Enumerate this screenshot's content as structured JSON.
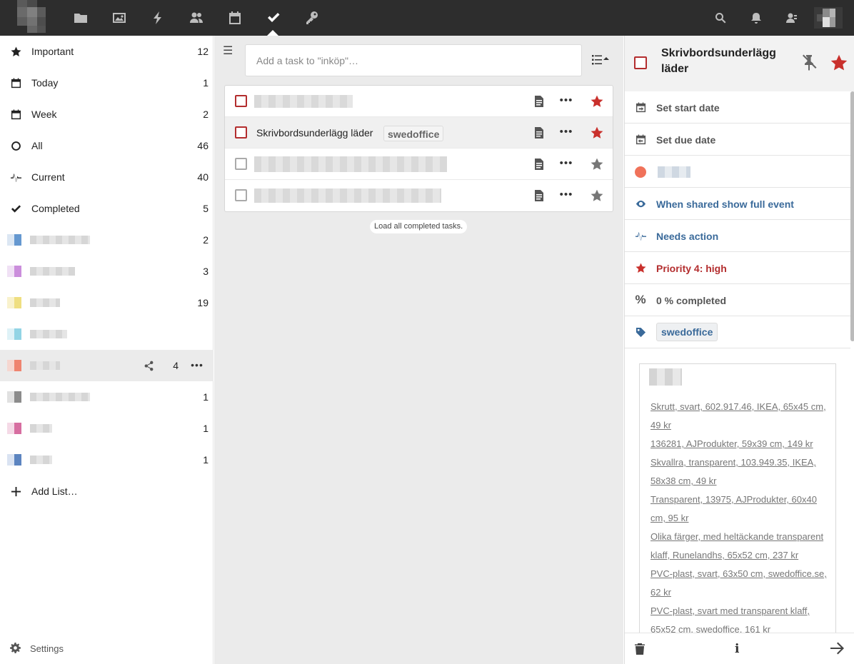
{
  "app": {
    "nav_icons": [
      "files-icon",
      "gallery-icon",
      "activity-icon",
      "contacts-icon",
      "calendar-icon",
      "tasks-icon",
      "passwords-icon"
    ],
    "active_app": "tasks-icon",
    "right_icons": [
      "search-icon",
      "notifications-icon",
      "contacts-menu-icon"
    ]
  },
  "sidebar": {
    "smart_lists": [
      {
        "label": "Important",
        "count": "12",
        "icon": "star-icon"
      },
      {
        "label": "Today",
        "count": "1",
        "icon": "calendar-day-icon"
      },
      {
        "label": "Week",
        "count": "2",
        "icon": "calendar-week-icon"
      },
      {
        "label": "All",
        "count": "46",
        "icon": "circle-icon"
      },
      {
        "label": "Current",
        "count": "40",
        "icon": "pulse-icon"
      },
      {
        "label": "Completed",
        "count": "5",
        "icon": "checkmark-icon"
      }
    ],
    "calendar_lists": [
      {
        "count": "2",
        "color": "#4a86c8"
      },
      {
        "count": "3",
        "color": "#c27ad6"
      },
      {
        "count": "19",
        "color": "#ecd96b"
      },
      {
        "count": "",
        "color": "#7fcde0"
      },
      {
        "count": "4",
        "color": "#f0725a"
      },
      {
        "count": "1",
        "color": "#777777"
      },
      {
        "count": "1",
        "color": "#d05590"
      },
      {
        "count": "1",
        "color": "#3f6fb5"
      }
    ],
    "add_list_label": "Add List…",
    "settings_label": "Settings"
  },
  "main": {
    "add_task_placeholder": "Add a task to \"inköp\"…",
    "tasks": [
      {
        "title": "",
        "tag": "",
        "important": true
      },
      {
        "title": "Skrivbordsunderlägg läder",
        "tag": "swedoffice",
        "important": true
      },
      {
        "title": "",
        "tag": "",
        "important": false
      },
      {
        "title": "",
        "tag": "",
        "important": false
      }
    ],
    "load_completed_label": "Load all completed tasks."
  },
  "details": {
    "title": "Skrivbordsunderlägg läder",
    "start_date_label": "Set start date",
    "due_date_label": "Set due date",
    "classification_label": "When shared show full event",
    "status_label": "Needs action",
    "priority_label": "Priority 4: high",
    "percent_label": "0 % completed",
    "tag": "swedoffice",
    "note_links": [
      "Skrutt, svart, 602.917.46, IKEA, 65x45 cm, 49 kr",
      "136281, AJProdukter, 59x39 cm, 149 kr",
      "Skvallra, transparent, 103.949.35, IKEA, 58x38 cm, 49 kr",
      "Transparent, 13975, AJProdukter, 60x40 cm, 95 kr",
      "Olika färger, med heltäckande transparent klaff, Runelandhs, 65x52 cm, 237 kr",
      "PVC-plast, svart, 63x50 cm, swedoffice.se, 62 kr",
      "PVC-plast, svart med transparent klaff, 65x52 cm, swedoffice, 161 kr"
    ],
    "colors": {
      "important": "#c9302c",
      "status_blue": "#3a6a9a",
      "priority_red": "#b32d2e"
    }
  }
}
